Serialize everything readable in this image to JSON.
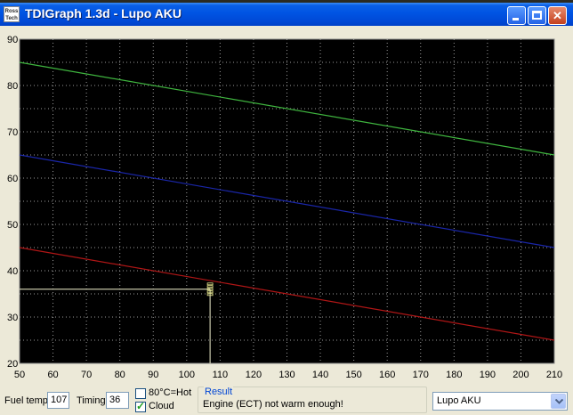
{
  "window": {
    "title": "TDIGraph 1.3d - Lupo AKU",
    "icon_text": "Ross Tech"
  },
  "chart_data": {
    "type": "line",
    "x": [
      50,
      210
    ],
    "xlim": [
      50,
      210
    ],
    "ylim": [
      20,
      90
    ],
    "x_ticks": [
      50,
      60,
      70,
      80,
      90,
      100,
      110,
      120,
      130,
      140,
      150,
      160,
      170,
      180,
      190,
      200,
      210
    ],
    "y_ticks": [
      20,
      30,
      40,
      50,
      60,
      70,
      80,
      90
    ],
    "grid": true,
    "series": [
      {
        "values": [
          85,
          65
        ],
        "color": "#3fb53f"
      },
      {
        "values": [
          65,
          45
        ],
        "color": "#1a26a8"
      },
      {
        "values": [
          45,
          25
        ],
        "color": "#b01616"
      }
    ],
    "marker": {
      "x": 107,
      "y": 36,
      "color": "#f2f2ce"
    }
  },
  "controls": {
    "fuel_temp_label": "Fuel temp",
    "fuel_temp_value": "107",
    "timing_label": "Timing",
    "timing_value": "36",
    "hot_checkbox_label": "80°C=Hot",
    "hot_checked": false,
    "cloud_checkbox_label": "Cloud",
    "cloud_checked": true,
    "result_title": "Result",
    "result_message": "Engine (ECT) not warm enough!",
    "engine_select_value": "Lupo AKU"
  }
}
